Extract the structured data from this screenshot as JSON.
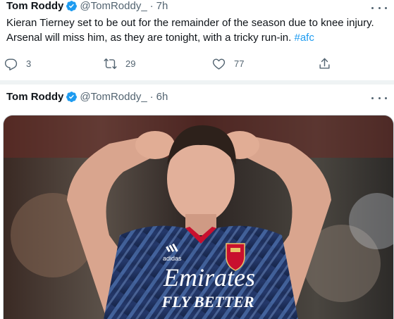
{
  "tweets": [
    {
      "author_name": "Tom Roddy",
      "handle": "@TomRoddy_",
      "separator": "·",
      "time": "7h",
      "text": "Kieran Tierney set to be out for the remainder of the season due to knee injury. Arsenal will miss him, as they are tonight, with a tricky run-in. ",
      "hashtag": "#afc",
      "actions": {
        "reply_count": "3",
        "retweet_count": "29",
        "like_count": "77"
      }
    },
    {
      "author_name": "Tom Roddy",
      "handle": "@TomRoddy_",
      "separator": "·",
      "time": "6h",
      "media": {
        "shirt_sponsor": "Emirates",
        "shirt_slogan": "FLY BETTER",
        "kit_brand": "adidas"
      }
    }
  ],
  "icons": {
    "verified": "verified-badge-icon",
    "more": "more-icon",
    "reply": "reply-icon",
    "retweet": "retweet-icon",
    "like": "like-icon",
    "share": "share-icon"
  },
  "colors": {
    "accent": "#1d9bf0",
    "text": "#0f1419",
    "muted": "#536471",
    "divider": "#eff3f4"
  }
}
